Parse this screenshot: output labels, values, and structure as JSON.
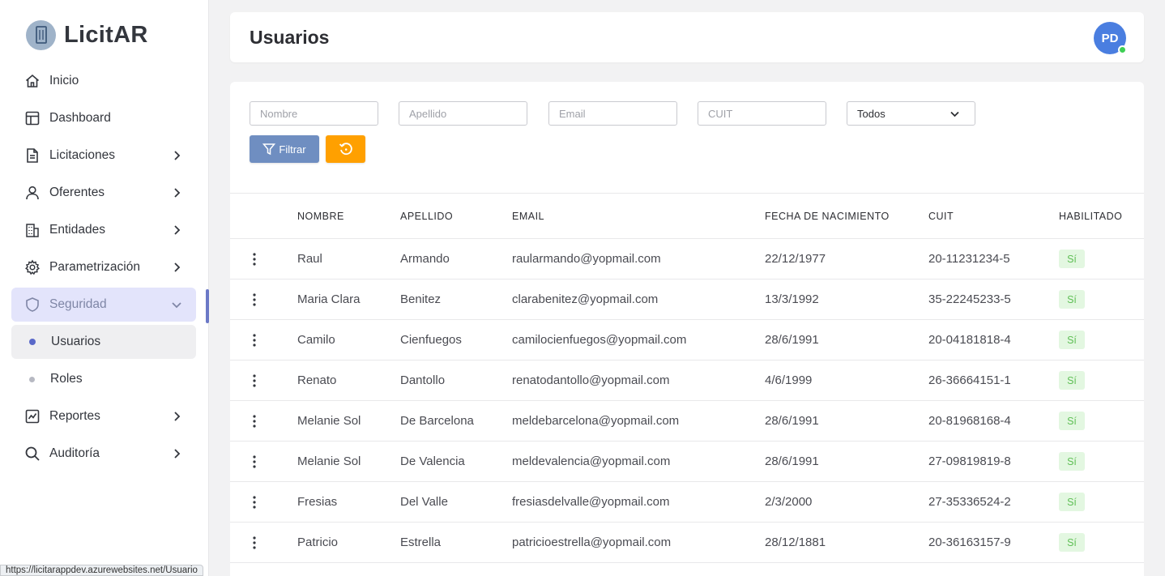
{
  "brand": {
    "name": "LicitAR",
    "logo_icon": "building-logo-icon"
  },
  "sidebar": {
    "items": [
      {
        "label": "Inicio",
        "icon": "home-icon",
        "has_children": false
      },
      {
        "label": "Dashboard",
        "icon": "dashboard-icon",
        "has_children": false
      },
      {
        "label": "Licitaciones",
        "icon": "document-icon",
        "has_children": true
      },
      {
        "label": "Oferentes",
        "icon": "user-icon",
        "has_children": true
      },
      {
        "label": "Entidades",
        "icon": "building-icon",
        "has_children": true
      },
      {
        "label": "Parametrización",
        "icon": "gear-icon",
        "has_children": true
      },
      {
        "label": "Seguridad",
        "icon": "shield-icon",
        "has_children": true,
        "expanded": true,
        "children": [
          {
            "label": "Usuarios",
            "active": true
          },
          {
            "label": "Roles",
            "active": false
          }
        ]
      },
      {
        "label": "Reportes",
        "icon": "chart-icon",
        "has_children": true
      },
      {
        "label": "Auditoría",
        "icon": "search-icon",
        "has_children": true
      }
    ]
  },
  "header": {
    "title": "Usuarios",
    "avatar_initials": "PD",
    "avatar_color": "#4a7ee0",
    "status_color": "#3ecf54"
  },
  "filters": {
    "nombre_placeholder": "Nombre",
    "apellido_placeholder": "Apellido",
    "email_placeholder": "Email",
    "cuit_placeholder": "CUIT",
    "estado_selected": "Todos",
    "filter_label": "Filtrar",
    "filter_color": "#6f8ec1",
    "reset_color": "#ffa000"
  },
  "table": {
    "columns": {
      "nombre": "NOMBRE",
      "apellido": "APELLIDO",
      "email": "EMAIL",
      "fecha": "FECHA DE NACIMIENTO",
      "cuit": "CUIT",
      "habilitado": "HABILITADO"
    },
    "rows": [
      {
        "nombre": "Raul",
        "apellido": "Armando",
        "email": "raularmando@yopmail.com",
        "fecha": "22/12/1977",
        "cuit": "20-11231234-5",
        "habilitado": "Sí"
      },
      {
        "nombre": "Maria Clara",
        "apellido": "Benitez",
        "email": "clarabenitez@yopmail.com",
        "fecha": "13/3/1992",
        "cuit": "35-22245233-5",
        "habilitado": "Sí"
      },
      {
        "nombre": "Camilo",
        "apellido": "Cienfuegos",
        "email": "camilocienfuegos@yopmail.com",
        "fecha": "28/6/1991",
        "cuit": "20-04181818-4",
        "habilitado": "Sí"
      },
      {
        "nombre": "Renato",
        "apellido": "Dantollo",
        "email": "renatodantollo@yopmail.com",
        "fecha": "4/6/1999",
        "cuit": "26-36664151-1",
        "habilitado": "Sí"
      },
      {
        "nombre": "Melanie Sol",
        "apellido": "De Barcelona",
        "email": "meldebarcelona@yopmail.com",
        "fecha": "28/6/1991",
        "cuit": "20-81968168-4",
        "habilitado": "Sí"
      },
      {
        "nombre": "Melanie Sol",
        "apellido": "De Valencia",
        "email": "meldevalencia@yopmail.com",
        "fecha": "28/6/1991",
        "cuit": "27-09819819-8",
        "habilitado": "Sí"
      },
      {
        "nombre": "Fresias",
        "apellido": "Del Valle",
        "email": "fresiasdelvalle@yopmail.com",
        "fecha": "2/3/2000",
        "cuit": "27-35336524-2",
        "habilitado": "Sí"
      },
      {
        "nombre": "Patricio",
        "apellido": "Estrella",
        "email": "patricioestrella@yopmail.com",
        "fecha": "28/12/1881",
        "cuit": "20-36163157-9",
        "habilitado": "Sí"
      }
    ]
  },
  "status_bar": {
    "url": "https://licitarappdev.azurewebsites.net/Usuario"
  }
}
